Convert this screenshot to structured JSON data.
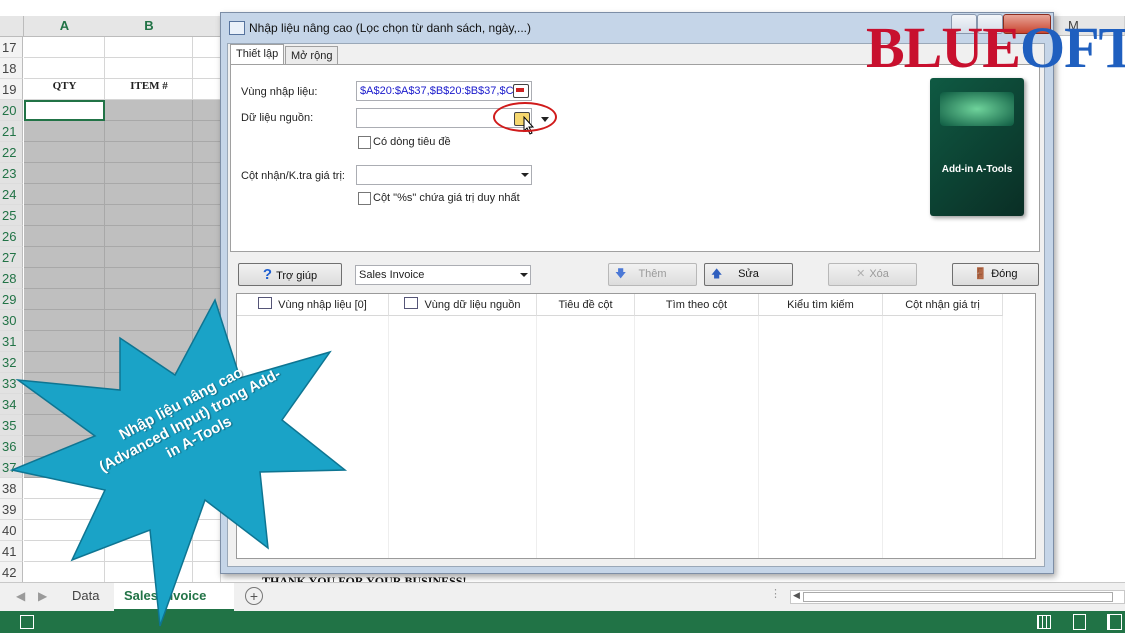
{
  "excel": {
    "columns": [
      "A",
      "B"
    ],
    "column_m": "M",
    "header_cells": {
      "qty": "QTY",
      "item": "ITEM #"
    },
    "rows": [
      "17",
      "18",
      "19",
      "20",
      "21",
      "22",
      "23",
      "24",
      "25",
      "26",
      "27",
      "28",
      "29",
      "30",
      "31",
      "32",
      "33",
      "34",
      "35",
      "36",
      "37",
      "38",
      "39",
      "40",
      "41",
      "42"
    ],
    "footer_text": "THANK YOU FOR YOUR BUSINESS!",
    "sheet_tabs": [
      {
        "label": "Data",
        "active": false
      },
      {
        "label": "Sales Invoice",
        "active": true
      }
    ],
    "add_sheet": "+",
    "accent_color": "#217346"
  },
  "dialog": {
    "title": "Nhập liệu nâng cao (Lọc chọn từ danh sách, ngày,...)",
    "tabs": [
      "Thiết lập",
      "Mở rộng"
    ],
    "fields": {
      "input_range_label": "Vùng nhập liệu:",
      "input_range_value": "$A$20:$A$37,$B$20:$B$37,$C$",
      "source_label": "Dữ liệu nguồn:",
      "source_value": "",
      "has_header_label": "Có dòng tiêu đề",
      "col_label": "Cột nhận/K.tra giá trị:",
      "col_value": "",
      "unique_label": "Cột \"%s\" chứa giá trị duy nhất"
    },
    "buttons": {
      "help": "Trợ giúp",
      "add": "Thêm",
      "edit": "Sửa",
      "delete": "Xóa",
      "close": "Đóng"
    },
    "sheet_select": "Sales Invoice",
    "grid_headers": [
      "Vùng nhập liệu [0]",
      "Vùng dữ liệu nguồn",
      "Tiêu đề cột",
      "Tìm theo cột",
      "Kiểu tìm kiếm",
      "Cột nhận giá trị"
    ]
  },
  "logo": {
    "text_left": "BLUE",
    "text_right": "OFTS",
    "red": "#c8102e",
    "blue": "#1f5fbf"
  },
  "product_box": {
    "title": "Add-in A-Tools"
  },
  "callout": {
    "text": "Nhập liệu nâng cao (Advanced Input) trong Add-in A-Tools",
    "color": "#1aa3c7"
  }
}
